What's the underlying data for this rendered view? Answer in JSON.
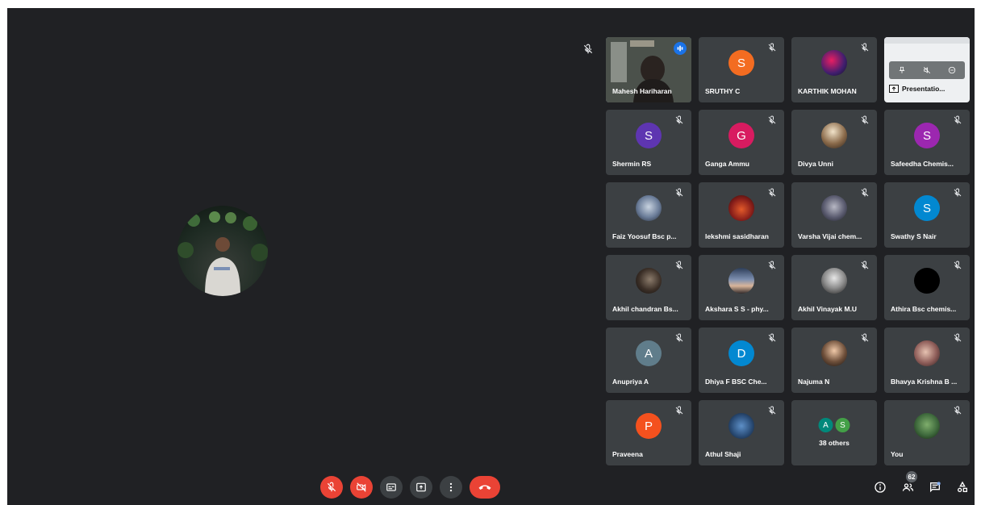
{
  "participants": [
    {
      "name": "Mahesh Hariharan",
      "type": "video",
      "speaking": true
    },
    {
      "name": "SRUTHY C",
      "type": "initial",
      "initial": "S",
      "color": "#f36c21"
    },
    {
      "name": "KARTHIK MOHAN",
      "type": "photo",
      "bg": "radial-gradient(circle at 40% 40%, #e91e63 0%, #3f1e6e 60%, #13141a 100%)"
    },
    {
      "name": "Presentation",
      "type": "presentation"
    },
    {
      "name": "Shermin RS",
      "type": "initial",
      "initial": "S",
      "color": "#5e35b1"
    },
    {
      "name": "Ganga Ammu",
      "type": "initial",
      "initial": "G",
      "color": "#d81b60"
    },
    {
      "name": "Divya Unni",
      "type": "photo",
      "bg": "radial-gradient(circle at 45% 35%, #f1e3c9 0%, #8a6a4a 55%, #2c211a 100%)"
    },
    {
      "name": "Safeedha Chemis...",
      "type": "initial",
      "initial": "S",
      "color": "#9c27b0"
    },
    {
      "name": "Faiz Yoosuf Bsc p...",
      "type": "photo",
      "bg": "radial-gradient(circle at 50% 45%, #c8d3e0 0%, #6b7d99 55%, #1f2633 100%)"
    },
    {
      "name": "lekshmi sasidharan",
      "type": "photo",
      "bg": "radial-gradient(circle at 50% 55%, #e35a2a 0%, #8a1f1a 55%, #280a09 100%)"
    },
    {
      "name": "Varsha Vijai chem...",
      "type": "photo",
      "bg": "radial-gradient(circle at 50% 45%, #b7b8c4 0%, #5b5c70 55%, #1b1c24 100%)"
    },
    {
      "name": "Swathy S Nair",
      "type": "initial",
      "initial": "S",
      "color": "#0288d1"
    },
    {
      "name": "Akhil chandran Bs...",
      "type": "photo",
      "bg": "radial-gradient(circle at 55% 45%, #8b7b6b 0%, #3a2e26 55%, #121010 100%)"
    },
    {
      "name": "Akshara S S - phy...",
      "type": "photo",
      "bg": "linear-gradient(180deg, #2d3d58 0%, #7c8fb0 45%, #d9b59a 70%, #322a2a 100%)"
    },
    {
      "name": "Akhil Vinayak M.U",
      "type": "photo",
      "bg": "radial-gradient(circle at 50% 40%, #e7e7e7 0%, #8d8d8d 50%, #1c1c1c 100%)"
    },
    {
      "name": "Athira Bsc chemis...",
      "type": "photo",
      "bg": "#000000"
    },
    {
      "name": "Anupriya A",
      "type": "initial",
      "initial": "A",
      "color": "#607d8b"
    },
    {
      "name": "Dhiya F BSC Che...",
      "type": "initial",
      "initial": "D",
      "color": "#0288d1"
    },
    {
      "name": "Najuma N",
      "type": "photo",
      "bg": "radial-gradient(circle at 50% 40%, #f0c9a8 0%, #6e4f3a 55%, #161210 100%)"
    },
    {
      "name": "Bhavya Krishna B ...",
      "type": "photo",
      "bg": "radial-gradient(circle at 45% 45%, #e6c2b1 0%, #8d5c58 55%, #2b1c1c 100%)"
    },
    {
      "name": "Praveena",
      "type": "initial",
      "initial": "P",
      "color": "#f4511e"
    },
    {
      "name": "Athul Shaji",
      "type": "photo",
      "bg": "radial-gradient(circle at 50% 50%, #5d8fc7 0%, #2c4f7a 55%, #0f1a2a 100%)"
    },
    {
      "name": "38 others",
      "type": "others"
    },
    {
      "name": "You",
      "type": "photo",
      "bg": "radial-gradient(circle at 50% 45%, #7fae6c 0%, #3f6a3d 55%, #13210f 100%)"
    }
  ],
  "others": {
    "initials": [
      "A",
      "S"
    ],
    "colors": [
      "#00897b",
      "#43a047"
    ]
  },
  "presentation": {
    "label": "Presentatio..."
  },
  "people_count": "62"
}
